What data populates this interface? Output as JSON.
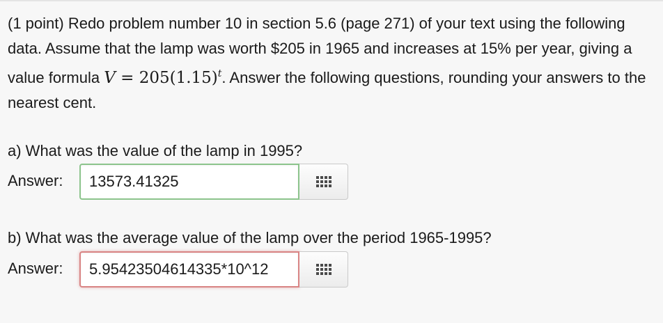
{
  "problem": {
    "text_before_formula": "(1 point) Redo problem number 10 in section 5.6 (page 271) of your text using the following data. Assume that the lamp was worth $205 in 1965 and increases at 15% per year, giving a value formula ",
    "formula_var": "V",
    "formula_rhs": " = 205(1.15)",
    "formula_exp": "t",
    "text_after_formula": ". Answer the following questions, rounding your answers to the nearest cent."
  },
  "questions": [
    {
      "prompt": "a) What was the value of the lamp in 1995?",
      "answer_label": "Answer:",
      "answer_value": "13573.41325",
      "status": "correct",
      "palette_icon": "equation-palette-icon"
    },
    {
      "prompt": "b) What was the average value of the lamp over the period 1965-1995?",
      "answer_label": "Answer:",
      "answer_value": "5.95423504614335*10^12",
      "status": "incorrect",
      "palette_icon": "equation-palette-icon"
    }
  ],
  "colors": {
    "correct_border": "#8cc48c",
    "incorrect_border": "#d98484",
    "background": "#f7f7f7"
  }
}
